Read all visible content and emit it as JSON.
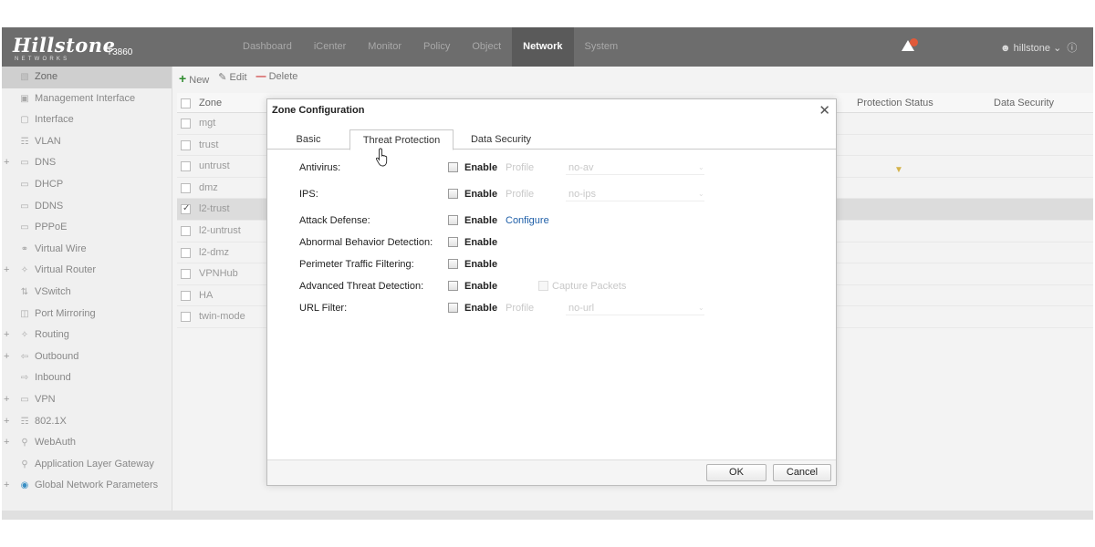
{
  "header": {
    "brand": "Hillstone",
    "brand_sub": "NETWORKS",
    "model": "T3860",
    "nav": [
      "Dashboard",
      "iCenter",
      "Monitor",
      "Policy",
      "Object",
      "Network",
      "System"
    ],
    "active_nav": "Network",
    "user": "hillstone"
  },
  "sidebar": {
    "items": [
      {
        "label": "Zone",
        "expandable": false,
        "icon": "zone-icon"
      },
      {
        "label": "Management Interface",
        "expandable": false,
        "icon": "management-icon"
      },
      {
        "label": "Interface",
        "expandable": false,
        "icon": "interface-icon"
      },
      {
        "label": "VLAN",
        "expandable": false,
        "icon": "vlan-icon"
      },
      {
        "label": "DNS",
        "expandable": true,
        "icon": "dns-icon"
      },
      {
        "label": "DHCP",
        "expandable": false,
        "icon": "dhcp-icon"
      },
      {
        "label": "DDNS",
        "expandable": false,
        "icon": "ddns-icon"
      },
      {
        "label": "PPPoE",
        "expandable": false,
        "icon": "pppoe-icon"
      },
      {
        "label": "Virtual Wire",
        "expandable": false,
        "icon": "virtual-wire-icon"
      },
      {
        "label": "Virtual Router",
        "expandable": true,
        "icon": "virtual-router-icon"
      },
      {
        "label": "VSwitch",
        "expandable": false,
        "icon": "vswitch-icon"
      },
      {
        "label": "Port Mirroring",
        "expandable": false,
        "icon": "port-mirroring-icon"
      },
      {
        "label": "Routing",
        "expandable": true,
        "icon": "routing-icon"
      },
      {
        "label": "Outbound",
        "expandable": true,
        "icon": "outbound-icon"
      },
      {
        "label": "Inbound",
        "expandable": false,
        "icon": "inbound-icon"
      },
      {
        "label": "VPN",
        "expandable": true,
        "icon": "vpn-icon"
      },
      {
        "label": "802.1X",
        "expandable": true,
        "icon": "dot1x-icon"
      },
      {
        "label": "WebAuth",
        "expandable": true,
        "icon": "webauth-icon"
      },
      {
        "label": "Application Layer Gateway",
        "expandable": false,
        "icon": "alg-icon"
      },
      {
        "label": "Global Network Parameters",
        "expandable": true,
        "icon": "globe-icon"
      }
    ]
  },
  "toolbar": {
    "new": "New",
    "edit": "Edit",
    "delete": "Delete"
  },
  "table": {
    "headers": {
      "zone": "Zone",
      "protection_status": "Protection Status",
      "data_security": "Data Security"
    },
    "rows": [
      "mgt",
      "trust",
      "untrust",
      "dmz",
      "l2-trust",
      "l2-untrust",
      "l2-dmz",
      "VPNHub",
      "HA",
      "twin-mode"
    ],
    "selected_row": "l2-trust"
  },
  "dialog": {
    "title": "Zone Configuration",
    "tabs": [
      "Basic",
      "Threat Protection",
      "Data Security"
    ],
    "active_tab": "Threat Protection",
    "fields": {
      "antivirus": {
        "label": "Antivirus:",
        "enable": "Enable",
        "profile_label": "Profile",
        "profile_value": "no-av"
      },
      "ips": {
        "label": "IPS:",
        "enable": "Enable",
        "profile_label": "Profile",
        "profile_value": "no-ips"
      },
      "attack_defense": {
        "label": "Attack Defense:",
        "enable": "Enable",
        "link": "Configure"
      },
      "abnormal": {
        "label": "Abnormal Behavior Detection:",
        "enable": "Enable"
      },
      "perimeter": {
        "label": "Perimeter Traffic Filtering:",
        "enable": "Enable"
      },
      "advanced": {
        "label": "Advanced Threat Detection:",
        "enable": "Enable",
        "capture": "Capture Packets"
      },
      "url": {
        "label": "URL Filter:",
        "enable": "Enable",
        "profile_label": "Profile",
        "profile_value": "no-url"
      }
    },
    "ok": "OK",
    "cancel": "Cancel"
  }
}
